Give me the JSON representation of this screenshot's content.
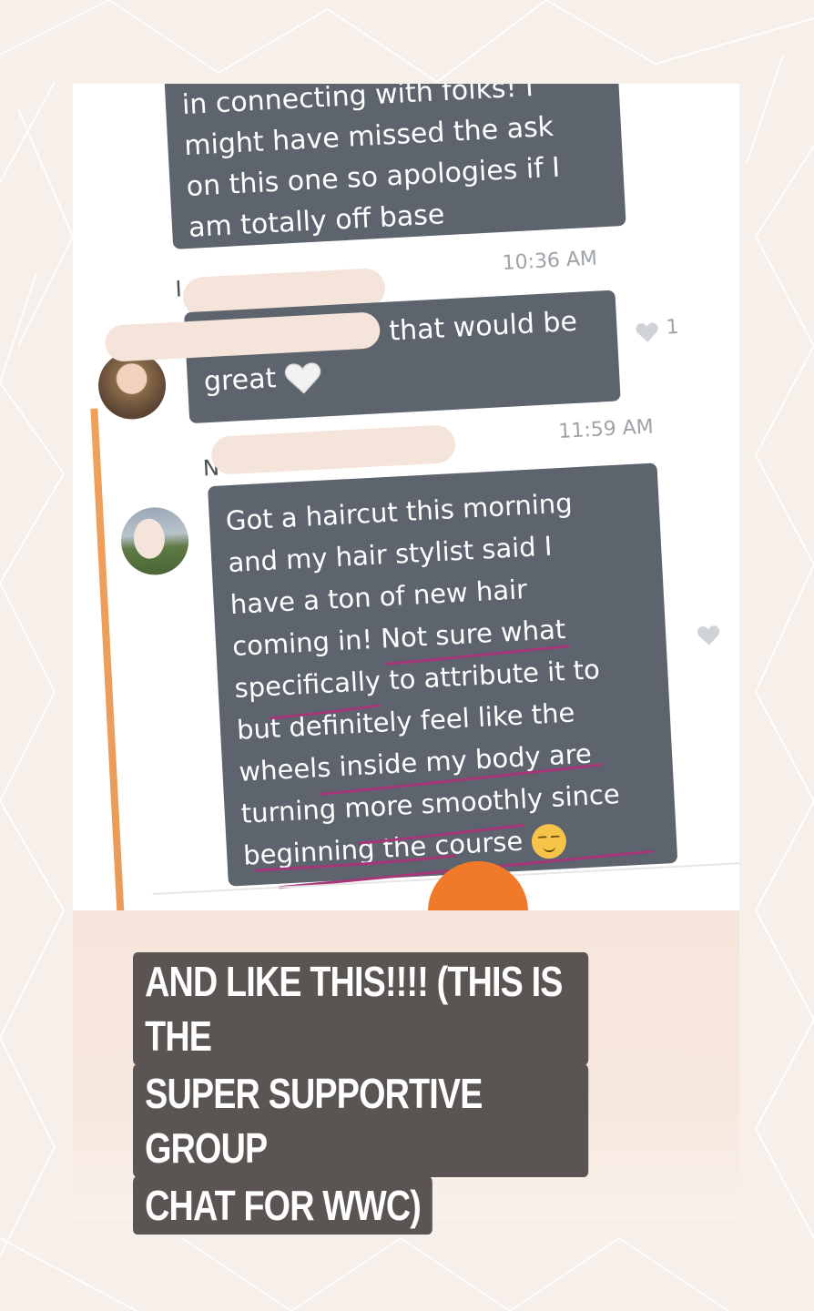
{
  "chat": {
    "messages": [
      {
        "lines": [
          "in connecting with folks! I",
          "might have missed the ask",
          "on this one so apologies if I",
          "am totally off base"
        ]
      },
      {
        "time": "10:36 AM",
        "name_fragment": "I",
        "text_part": "that would be",
        "text_part2": "great",
        "emoji": "white-heart",
        "likes": "1"
      },
      {
        "time": "11:59 AM",
        "name_fragment": "N",
        "lines": [
          "Got a haircut this morning",
          "and my hair stylist said I",
          "have a ton of new hair",
          "coming in! Not sure what",
          "specifically to attribute it to",
          "but definitely feel like the",
          "wheels inside my body are",
          "turning more smoothly since",
          "beginning the course"
        ],
        "emoji": "smiling-face-with-closed-eyes"
      }
    ]
  },
  "caption": {
    "line1": "AND LIKE THIS!!!! (THIS IS THE",
    "line2": "SUPER SUPPORTIVE GROUP",
    "line3": "CHAT FOR WWC)"
  },
  "colors": {
    "bubble": "#5d646d",
    "caption_bg": "#5a5552",
    "marker": "#a6367a",
    "accent_orange": "#f07a2a",
    "background": "#f7efe9"
  }
}
